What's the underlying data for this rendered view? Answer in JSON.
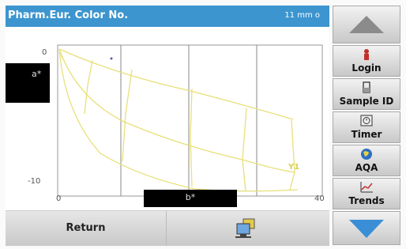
{
  "header": {
    "title": "Pharm.Eur. Color No.",
    "range": "11 mm o"
  },
  "plot": {
    "y_axis_label": "a*",
    "x_axis_label": "b*",
    "y_ticks": [
      "0",
      "-10"
    ],
    "x_ticks": [
      "0",
      "40"
    ],
    "series_label": "Y1"
  },
  "footer": {
    "return_label": "Return",
    "send_icon": "send-data-icon"
  },
  "sidebar": {
    "login_label": "Login",
    "sample_id_label": "Sample ID",
    "timer_label": "Timer",
    "aqa_label": "AQA",
    "trends_label": "Trends"
  },
  "colors": {
    "title_bar": "#3c95cf",
    "curve": "#e8e07a"
  }
}
